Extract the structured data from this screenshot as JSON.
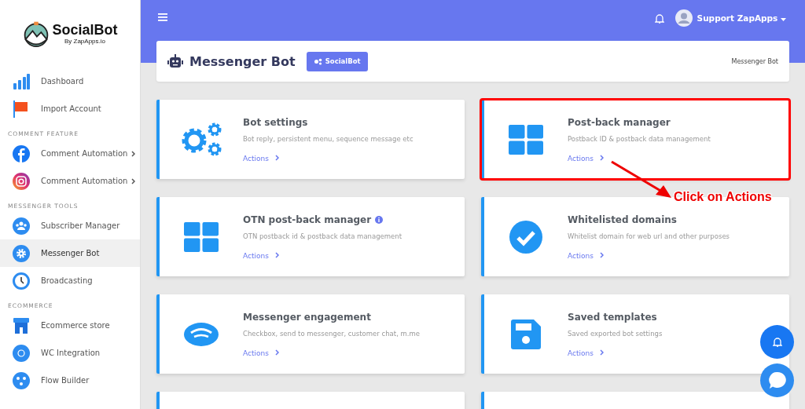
{
  "brand": {
    "name": "SocialBot",
    "tagline": "By ZapApps.io"
  },
  "sidebar": {
    "sections": [
      {
        "items": [
          {
            "label": "Dashboard",
            "selected": false,
            "has_submenu": false
          },
          {
            "label": "Import Account",
            "selected": false,
            "has_submenu": false
          }
        ]
      },
      {
        "heading": "COMMENT FEATURE",
        "items": [
          {
            "label": "Comment Automation",
            "selected": false,
            "has_submenu": true
          },
          {
            "label": "Comment Automation",
            "selected": false,
            "has_submenu": true
          }
        ]
      },
      {
        "heading": "MESSENGER TOOLS",
        "items": [
          {
            "label": "Subscriber Manager",
            "selected": false,
            "has_submenu": false
          },
          {
            "label": "Messenger Bot",
            "selected": true,
            "has_submenu": false
          },
          {
            "label": "Broadcasting",
            "selected": false,
            "has_submenu": false
          }
        ]
      },
      {
        "heading": "ECOMMERCE",
        "items": [
          {
            "label": "Ecommerce store",
            "selected": false,
            "has_submenu": false
          },
          {
            "label": "WC Integration",
            "selected": false,
            "has_submenu": false
          },
          {
            "label": "Flow Builder",
            "selected": false,
            "has_submenu": false
          }
        ]
      }
    ]
  },
  "topbar": {
    "user": "Support ZapApps"
  },
  "header": {
    "title": "Messenger Bot",
    "badge": "SocialBot",
    "breadcrumb": "Messenger Bot"
  },
  "cards": [
    {
      "kind": "card",
      "title": "Bot settings",
      "info": false,
      "description": "Bot reply, persistent menu, sequence message etc",
      "action": "Actions",
      "highlighted": false
    },
    {
      "kind": "card",
      "title": "Post-back manager",
      "info": false,
      "description": "Postback ID & postback data management",
      "action": "Actions",
      "highlighted": true
    },
    {
      "kind": "card",
      "title": "OTN post-back manager",
      "info": true,
      "description": "OTN postback id & postback data management",
      "action": "Actions",
      "highlighted": false
    },
    {
      "kind": "card",
      "title": "Whitelisted domains",
      "info": false,
      "description": "Whitelist domain for web url and other purposes",
      "action": "Actions",
      "highlighted": false
    },
    {
      "kind": "card",
      "title": "Messenger engagement",
      "info": false,
      "description": "Checkbox, send to messenger, customer chat, m.me",
      "action": "Actions",
      "highlighted": false
    },
    {
      "kind": "card",
      "title": "Saved templates",
      "info": false,
      "description": "Saved exported bot settings",
      "action": "Actions",
      "highlighted": false
    },
    {
      "kind": "cut"
    },
    {
      "kind": "cut"
    }
  ],
  "annotation": {
    "text": "Click on Actions"
  }
}
